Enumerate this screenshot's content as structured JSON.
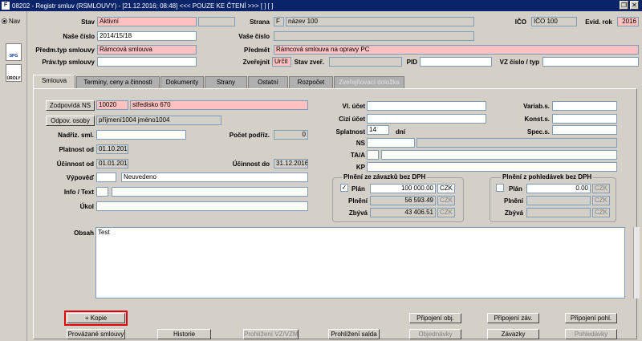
{
  "window": {
    "title": "08202 - Registr smluv (RSMLOUVY) - [21.12.2016; 08:48] <<< POUZE KE ČTENÍ >>> [ ] [ ]",
    "icon_label": "F"
  },
  "left": {
    "nav_label": "Nav",
    "spg_label": "SPG",
    "oroly_label": "ÚROLY"
  },
  "header": {
    "stav_label": "Stav",
    "stav": "Aktivní",
    "stav2": "",
    "strana_label": "Strana",
    "strana_code": "F",
    "strana_name": "název 100",
    "ico_label": "IČO",
    "ico": "IČO 100",
    "evid_rok_label": "Evid. rok",
    "evid_rok": "2016",
    "nase_cislo_label": "Naše číslo",
    "nase_cislo": "2014/15/18",
    "vase_cislo_label": "Vaše číslo",
    "vase_cislo": "",
    "predm_typ_label": "Předm.typ smlouvy",
    "predm_typ": "Rámcová smlouva",
    "predmet_label": "Předmět",
    "predmet": "Rámcová smlouva na opravy PC",
    "prav_typ_label": "Práv.typ smlouvy",
    "prav_typ": "",
    "zverejnit_label": "Zveřejnit",
    "zverejnit": "Určit",
    "stav_zver_label": "Stav zveř.",
    "stav_zver": "",
    "pid_label": "PID",
    "pid": "",
    "vz_label": "VZ číslo / typ",
    "vz": ""
  },
  "tabs": [
    {
      "label": "Smlouva",
      "active": true,
      "enabled": true
    },
    {
      "label": "Termíny, ceny a činnosti",
      "active": false,
      "enabled": true
    },
    {
      "label": "Dokumenty",
      "active": false,
      "enabled": true
    },
    {
      "label": "Strany",
      "active": false,
      "enabled": true
    },
    {
      "label": "Ostatní",
      "active": false,
      "enabled": true
    },
    {
      "label": "Rozpočet",
      "active": false,
      "enabled": true
    },
    {
      "label": "Zveřejňovací doložka",
      "active": false,
      "enabled": false
    }
  ],
  "form": {
    "zodpovida_btn": "Zodpovídá NS",
    "zodpovida_code": "10020",
    "zodpovida_name": "středisko 670",
    "odpov_btn": "Odpov. osoby",
    "odpov_value": "příjmení1004 jméno1004",
    "nadriz_label": "Nadřiz. sml.",
    "nadriz": "",
    "pocet_label": "Počet podříz.",
    "pocet": "0",
    "platnost_label": "Platnost od",
    "platnost": "01.10.2016",
    "ucinnost_label": "Účinnost od",
    "ucinnost": "01.01.2014",
    "ucinnost_do_label": "Účinnost do",
    "ucinnost_do": "31.12.2016",
    "vypoved_label": "Výpověď",
    "vypoved_code": "",
    "vypoved_text": "Neuvedeno",
    "info_label": "Info / Text",
    "info_code": "",
    "info_text": "",
    "ukol_label": "Úkol",
    "ukol": "",
    "vl_ucet_label": "Vl. účet",
    "cizi_ucet_label": "Cizí účet",
    "splatnost_label": "Splatnost",
    "splatnost": "14",
    "splatnost_unit": "dní",
    "ns_label": "NS",
    "ta_label": "TA/A",
    "kp_label": "KP",
    "variab_label": "Variab.s.",
    "konst_label": "Konst.s.",
    "spec_label": "Spec.s.",
    "obsah_label": "Obsah",
    "obsah": "Test"
  },
  "plneni_zav": {
    "title": "Plnění ze závazků bez DPH",
    "plan_label": "Plán",
    "plan_checked": true,
    "plan": "100 000.00",
    "plan_cur": "CZK",
    "plneni_label": "Plnění",
    "plneni": "56 593.49",
    "plneni_cur": "CZK",
    "zbyva_label": "Zbývá",
    "zbyva": "43 406.51",
    "zbyva_cur": "CZK"
  },
  "plneni_pohl": {
    "title": "Plnění z pohledávek bez DPH",
    "plan_label": "Plán",
    "plan_checked": false,
    "plan": "0.00",
    "plan_cur": "CZK",
    "plneni_label": "Plnění",
    "plneni": "",
    "plneni_cur": "CZK",
    "zbyva_label": "Zbývá",
    "zbyva": "",
    "zbyva_cur": "CZK"
  },
  "buttons": {
    "kopie": "+ Kopie",
    "pripojeni_obj": "Připojení obj.",
    "pripojeni_zav": "Připojení záv.",
    "pripojeni_pohl": "Připojení pohl.",
    "provazane": "Provázané smlouvy",
    "historie": "Historie",
    "prohlizeni_vz": "Prohlížení VZ/VZM",
    "prohlizeni_salda": "Prohlížení salda",
    "objednavky": "Objednávky",
    "zavazky": "Závazky",
    "pohledavky": "Pohledávky"
  },
  "colors": {
    "titlebar": "#0a246a",
    "required": "#ffc0c0",
    "highlight": "#e00000"
  }
}
